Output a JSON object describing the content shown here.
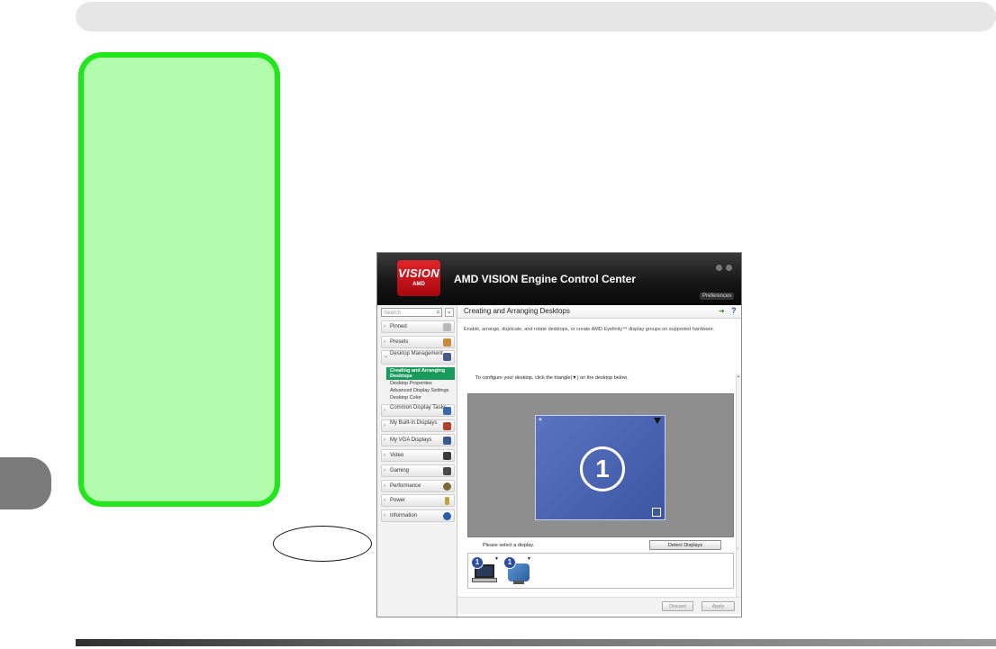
{
  "app": {
    "logo_top": "VISION",
    "logo_bottom": "AMD",
    "title": "AMD VISION Engine Control Center",
    "preferences_label": "Preferences"
  },
  "sidebar": {
    "search_placeholder": "Search",
    "collapse_glyph": "«",
    "items": [
      {
        "label": "Pinned",
        "icon": "pin-icon",
        "color": "#b8b8b8"
      },
      {
        "label": "Presets",
        "icon": "pencil-icon",
        "color": "#c98a3a"
      },
      {
        "label": "Desktop Management",
        "icon": "desktop-icon",
        "color": "#4a5a8a"
      },
      {
        "label": "Common Display Tasks",
        "icon": "display-tasks-icon",
        "color": "#3a6aa8"
      },
      {
        "label": "My Built-in Displays",
        "icon": "laptop-icon",
        "color": "#b04030"
      },
      {
        "label": "My VGA Displays",
        "icon": "vga-display-icon",
        "color": "#3a5a8a"
      },
      {
        "label": "Video",
        "icon": "video-icon",
        "color": "#3a3a3a"
      },
      {
        "label": "Gaming",
        "icon": "gaming-icon",
        "color": "#4a4a4a"
      },
      {
        "label": "Performance",
        "icon": "gauge-icon",
        "color": "#7a6a3a"
      },
      {
        "label": "Power",
        "icon": "battery-icon",
        "color": "#c0a040"
      },
      {
        "label": "Information",
        "icon": "info-icon",
        "color": "#2a5aa8"
      }
    ],
    "sub_items": [
      {
        "label": "Creating and Arranging Desktops"
      },
      {
        "label": "Desktop Properties"
      },
      {
        "label": "Advanced Display Settings"
      },
      {
        "label": "Desktop Color"
      }
    ]
  },
  "content": {
    "title": "Creating and Arranging Desktops",
    "help_glyph": "?",
    "pin_glyph": "➜",
    "description": "Enable, arrange, duplicate, and rotate desktops, or create AMD Eyefinity™ display groups on supported hardware.",
    "instruction": "To configure your desktop, click the triangle(▼) on the desktop below.",
    "monitor_number": "1",
    "select_display_text": "Please select a display.",
    "detect_button": "Detect Displays",
    "thumb_badges": [
      "1",
      "1"
    ],
    "discard_button": "Discard",
    "apply_button": "Apply"
  }
}
